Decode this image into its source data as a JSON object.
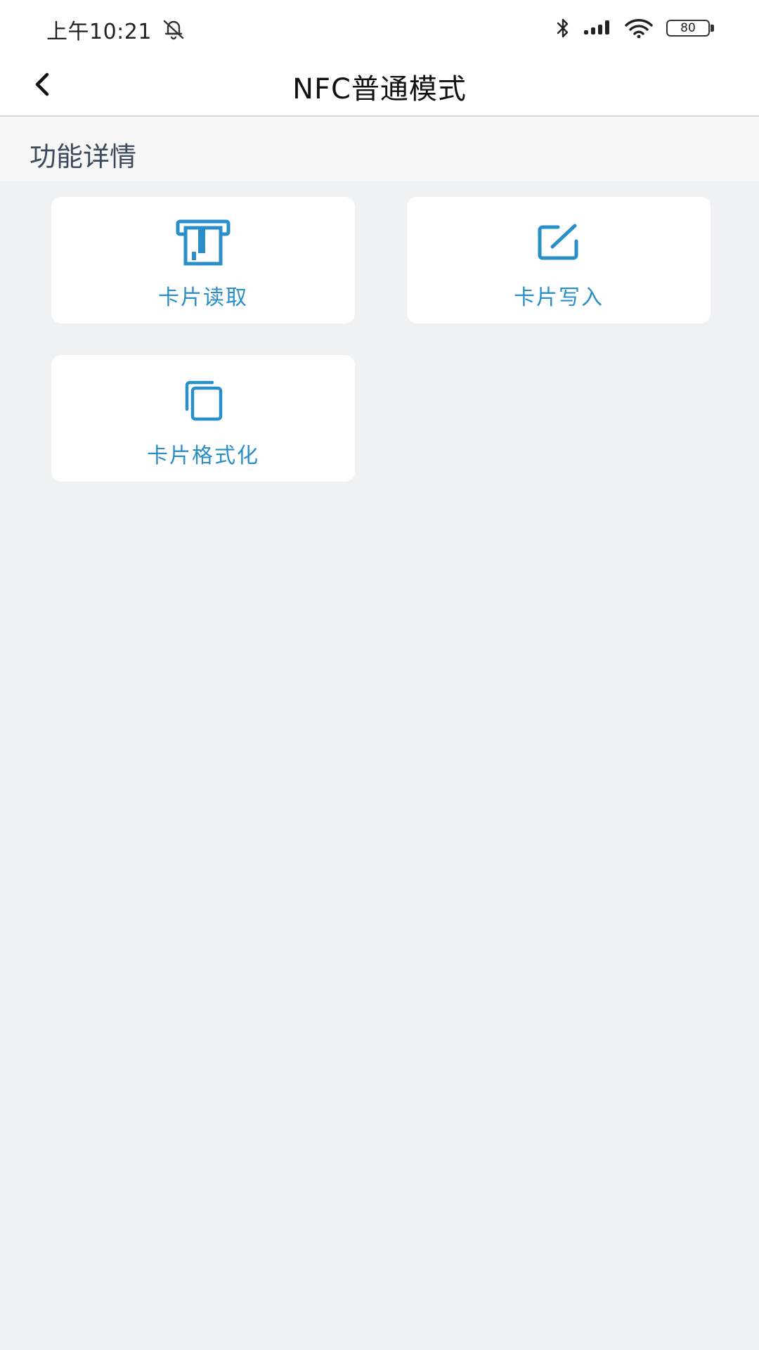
{
  "status_bar": {
    "time": "上午10:21",
    "battery": "80",
    "icons": [
      "bell-off-icon",
      "bluetooth-icon",
      "signal-icon",
      "wifi-icon",
      "battery-icon"
    ]
  },
  "header": {
    "title": "NFC普通模式",
    "back_icon": "chevron-left-icon"
  },
  "section": {
    "title": "功能详情"
  },
  "tiles": [
    {
      "label": "卡片读取",
      "icon": "card-read-icon"
    },
    {
      "label": "卡片写入",
      "icon": "edit-icon"
    },
    {
      "label": "卡片格式化",
      "icon": "copy-icon"
    }
  ],
  "colors": {
    "accent": "#2a8fc7",
    "background": "#f0f1f3",
    "tile": "#ffffff",
    "section_text": "#3c4a5e"
  }
}
